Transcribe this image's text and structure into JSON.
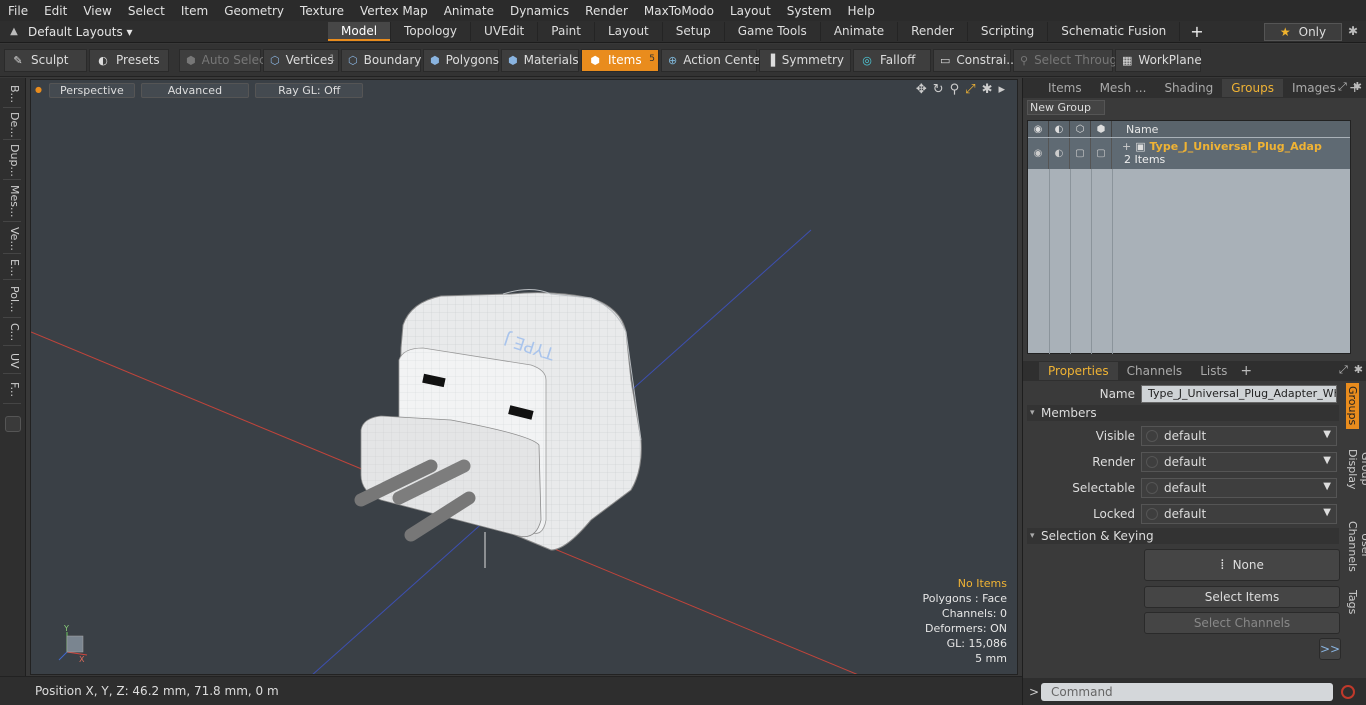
{
  "menu": [
    "File",
    "Edit",
    "View",
    "Select",
    "Item",
    "Geometry",
    "Texture",
    "Vertex Map",
    "Animate",
    "Dynamics",
    "Render",
    "MaxToModo",
    "Layout",
    "System",
    "Help"
  ],
  "layout_selector": "Default Layouts ▾",
  "layout_tabs": [
    "Model",
    "Topology",
    "UVEdit",
    "Paint",
    "Layout",
    "Setup",
    "Game Tools",
    "Animate",
    "Render",
    "Scripting",
    "Schematic Fusion"
  ],
  "active_layout_tab": "Model",
  "only_label": "Only",
  "toolbar": {
    "sculpt": "Sculpt",
    "presets": "Presets",
    "auto_select": "Auto Select",
    "vertices": "Vertices",
    "vertices_count": "1",
    "boundary": "Boundary",
    "polygons": "Polygons",
    "materials": "Materials",
    "items": "Items",
    "items_count": "5",
    "action_center": "Action Center",
    "symmetry": "Symmetry",
    "falloff": "Falloff",
    "constraints": "Constrai...",
    "select_through": "Select Through",
    "workplane": "WorkPlane"
  },
  "left_tabs": [
    "B...",
    "De...",
    "Dup...",
    "Mes...",
    "Ve...",
    "E...",
    "Pol...",
    "C...",
    "UV",
    "F..."
  ],
  "viewport": {
    "perspective": "Perspective",
    "advanced": "Advanced",
    "raygl": "Ray GL: Off",
    "plug_text": "TYPE J",
    "stats": {
      "no_items": "No Items",
      "polygons": "Polygons : Face",
      "channels": "Channels: 0",
      "deformers": "Deformers: ON",
      "gl": "GL: 15,086",
      "scale": "5 mm"
    }
  },
  "status": "Position X, Y, Z:   46.2 mm, 71.8 mm, 0 m",
  "right_top_tabs": [
    "Items",
    "Mesh ...",
    "Shading",
    "Groups",
    "Images"
  ],
  "right_top_active": "Groups",
  "new_group": "New Group",
  "group_list": {
    "header_name": "Name",
    "row_name": "Type_J_Universal_Plug_Adapte ...",
    "row_sub": "2 Items"
  },
  "props_tabs": [
    "Properties",
    "Channels",
    "Lists"
  ],
  "props_active": "Properties",
  "props": {
    "name_label": "Name",
    "name_value": "Type_J_Universal_Plug_Adapter_Whit",
    "members": "Members",
    "visible_label": "Visible",
    "visible_value": "default",
    "render_label": "Render",
    "render_value": "default",
    "selectable_label": "Selectable",
    "selectable_value": "default",
    "locked_label": "Locked",
    "locked_value": "default",
    "sel_keying": "Selection & Keying",
    "none_btn": "None",
    "select_items": "Select Items",
    "select_channels": "Select Channels",
    "more": ">>"
  },
  "side_vtabs": [
    "Groups",
    "Group Display",
    "User Channels",
    "Tags"
  ],
  "command_placeholder": "Command",
  "colors": {
    "accent": "#e98c1d",
    "highlight": "#f0b334",
    "viewport_bg": "#3a4046"
  }
}
